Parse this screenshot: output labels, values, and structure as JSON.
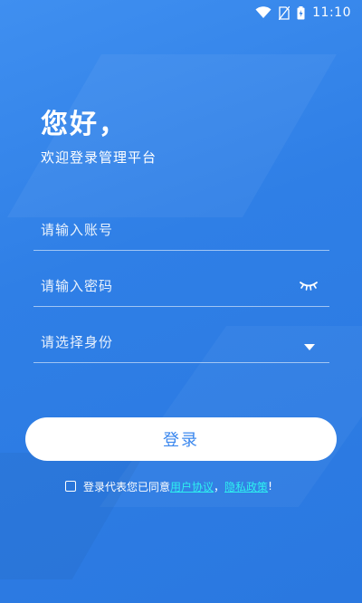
{
  "status_bar": {
    "time": "11:10",
    "icons": [
      "wifi-icon",
      "no-sim-icon",
      "battery-charging-icon"
    ]
  },
  "header": {
    "greeting": "您好，",
    "subtitle": "欢迎登录管理平台"
  },
  "form": {
    "account_placeholder": "请输入账号",
    "password_placeholder": "请输入密码",
    "role_placeholder": "请选择身份",
    "password_toggle_icon": "eye-closed-icon",
    "role_dropdown_icon": "dropdown-arrow-icon"
  },
  "login_button": {
    "label": "登录"
  },
  "agreement": {
    "prefix": "登录代表您已同意",
    "user_agreement": "用户协议",
    "separator": "，",
    "privacy_policy": "隐私政策",
    "suffix": "!"
  },
  "colors": {
    "background": "#2f7fe6",
    "button_text": "#3a87ee",
    "link": "#2ef0f0"
  }
}
